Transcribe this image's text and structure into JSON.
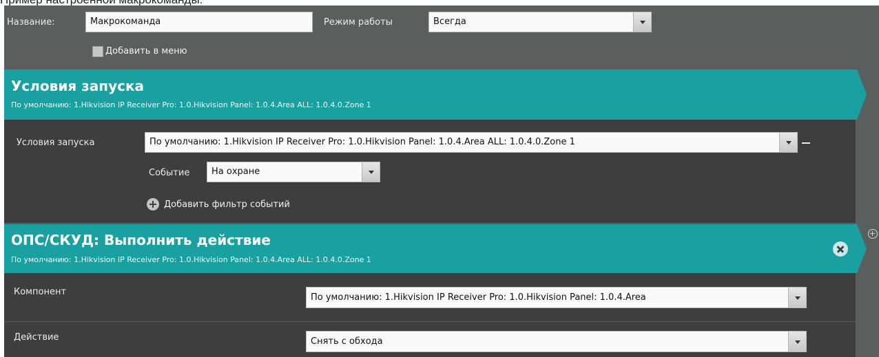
{
  "caption": "Пример настроенной макрокоманды:",
  "header": {
    "name_label": "Название:",
    "name_value": "Макрокоманда",
    "mode_label": "Режим работы",
    "mode_value": "Всегда",
    "add_to_menu_label": "Добавить в меню",
    "add_to_menu_checked": false
  },
  "trigger_section": {
    "title": "Условия запуска",
    "subtitle": "По умолчанию: 1.Hikvision IP Receiver Pro: 1.0.Hikvision Panel: 1.0.4.Area ALL: 1.0.4.0.Zone 1",
    "condition_label": "Условия запуска",
    "condition_value": "По умолчанию: 1.Hikvision IP Receiver Pro: 1.0.Hikvision Panel: 1.0.4.Area ALL: 1.0.4.0.Zone 1",
    "event_label": "Событие",
    "event_value": "На охране",
    "add_filter_label": "Добавить фильтр событий"
  },
  "action_section": {
    "title": "ОПС/СКУД: Выполнить действие",
    "subtitle": "По умолчанию: 1.Hikvision IP Receiver Pro: 1.0.Hikvision Panel: 1.0.4.Area ALL: 1.0.4.0.Zone 1",
    "component_label": "Компонент",
    "component_value": "По умолчанию: 1.Hikvision IP Receiver Pro: 1.0.Hikvision Panel: 1.0.4.Area",
    "action_label": "Действие",
    "action_value": "Снять с обхода"
  },
  "colors": {
    "panel_bg": "#595f5f",
    "accent_teal": "#1aa0a1",
    "section_dark": "#3e3e3e"
  }
}
